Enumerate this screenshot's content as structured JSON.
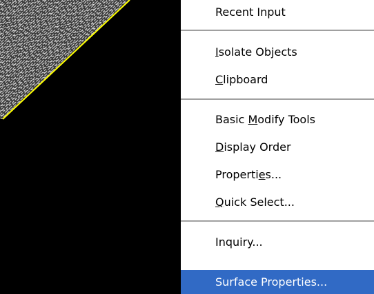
{
  "menu": {
    "items": [
      {
        "label": "Recent Input",
        "mnemonic": null
      },
      {
        "label": "Isolate Objects",
        "mnemonic": 0
      },
      {
        "label": "Clipboard",
        "mnemonic": 0
      },
      {
        "label": "Basic Modify Tools",
        "mnemonic": 6
      },
      {
        "label": "Display Order",
        "mnemonic": 0
      },
      {
        "label": "Properties...",
        "mnemonic": 8
      },
      {
        "label": "Quick Select...",
        "mnemonic": 0
      },
      {
        "label": "Inquiry...",
        "mnemonic": null
      },
      {
        "label": "Surface Properties...",
        "mnemonic": null
      }
    ],
    "highlighted_index": 8
  },
  "colors": {
    "highlight": "#316ac5",
    "drawing_background": "#000000",
    "boundary_line": "#ffff00",
    "hatch": "#c8c8c8"
  }
}
